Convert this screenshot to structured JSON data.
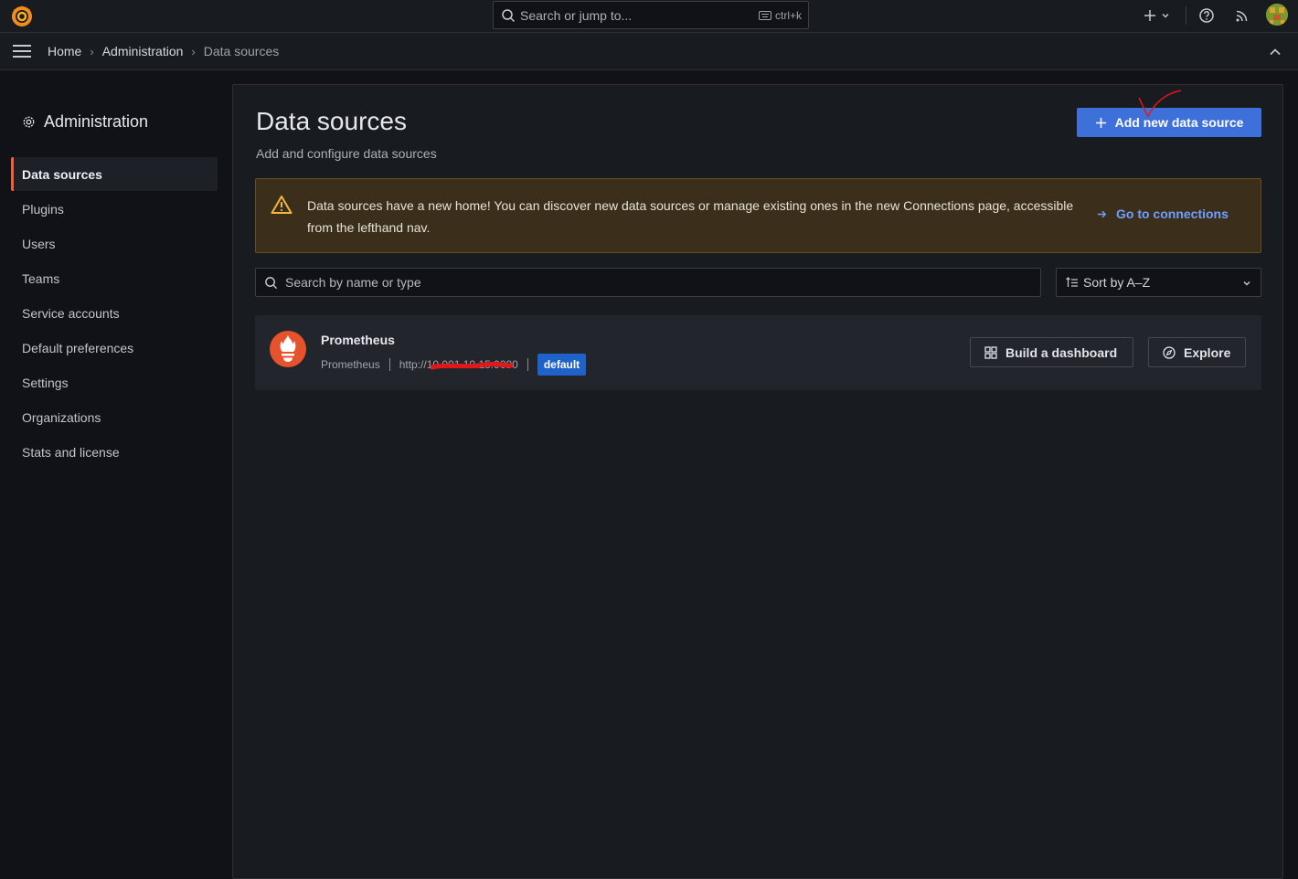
{
  "topbar": {
    "search_placeholder": "Search or jump to...",
    "shortcut": "ctrl+k",
    "icons": [
      "grafana-logo-icon",
      "search-icon",
      "keyboard-icon",
      "plus-icon",
      "chevron-down-icon",
      "help-icon",
      "rss-icon",
      "avatar"
    ]
  },
  "breadcrumb": {
    "items": [
      "Home",
      "Administration",
      "Data sources"
    ]
  },
  "sidebar": {
    "title": "Administration",
    "items": [
      {
        "label": "Data sources",
        "active": true
      },
      {
        "label": "Plugins"
      },
      {
        "label": "Users"
      },
      {
        "label": "Teams"
      },
      {
        "label": "Service accounts"
      },
      {
        "label": "Default preferences"
      },
      {
        "label": "Settings"
      },
      {
        "label": "Organizations"
      },
      {
        "label": "Stats and license"
      }
    ]
  },
  "main": {
    "title": "Data sources",
    "subtitle": "Add and configure data sources",
    "add_button": "Add new data source",
    "alert": {
      "text": "Data sources have a new home! You can discover new data sources or manage existing ones in the new Connections page, accessible from the lefthand nav.",
      "link": "Go to connections"
    },
    "search_placeholder": "Search by name or type",
    "sort_label": "Sort by A–Z",
    "datasources": [
      {
        "name": "Prometheus",
        "type": "Prometheus",
        "url": "http://10.001.10.15:9090",
        "badge": "default",
        "build_label": "Build a dashboard",
        "explore_label": "Explore"
      }
    ]
  },
  "colors": {
    "accent": "#3d71d9",
    "brand": "#f55f3e",
    "warning_bg": "#3b2f1c",
    "link": "#6e9fff"
  }
}
